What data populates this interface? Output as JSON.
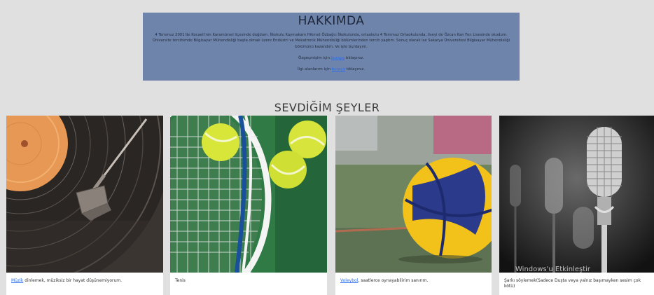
{
  "about": {
    "title": "HAKKIMDA",
    "bio": "4 Temmuz 2001'de Kocaeli'nin Karamürsel ilçesinde doğdum. İlkokulu Kaymakam Hikmet Özbağcı İlkokulunda, ortaokulu 4 Temmuz Ortaokulunda, liseyi de Özcan Kan Fen Lisesinde okudum. Üniversite tercihimde Bilgisayar Mühendisliği başta olmak üzere Endüstri ve Mekatronik Mühendisliği bölümlerinden tercih yaptım. Sonuç olarak ise Sakarya Üniversitesi Bilgisayar Mühendisliği bölümünü kazandım. Ve işte burdayım.",
    "cv_prefix": "Özgeçmişim için ",
    "cv_link": "buraya",
    "cv_suffix": " tıklayınız.",
    "interest_prefix": "İlgi alanlarım için ",
    "interest_link": "buraya",
    "interest_suffix": " tıklayınız."
  },
  "section": {
    "title": "SEVDİĞİM ŞEYLER"
  },
  "cards": [
    {
      "image": "vinyl-record-image",
      "link": "Müzik",
      "text": " dinlemek, müziksiz bir hayat düşünemiyorum."
    },
    {
      "image": "tennis-balls-image",
      "link": "",
      "text": "Tenis"
    },
    {
      "image": "volleyball-image",
      "link": "Voleybol",
      "text": ", saatlerce oynayabilirim sanırım."
    },
    {
      "image": "microphone-image",
      "link": "",
      "text": "Şarkı söylemek(Sadece Duşta veya yalnız başımayken sesim çok kötü)"
    }
  ],
  "watermark": "Windows'u Etkinleştir",
  "colors": {
    "about_bg": "#6f84ab",
    "page_bg": "#e0e0e0",
    "link": "#2a6cf0"
  }
}
